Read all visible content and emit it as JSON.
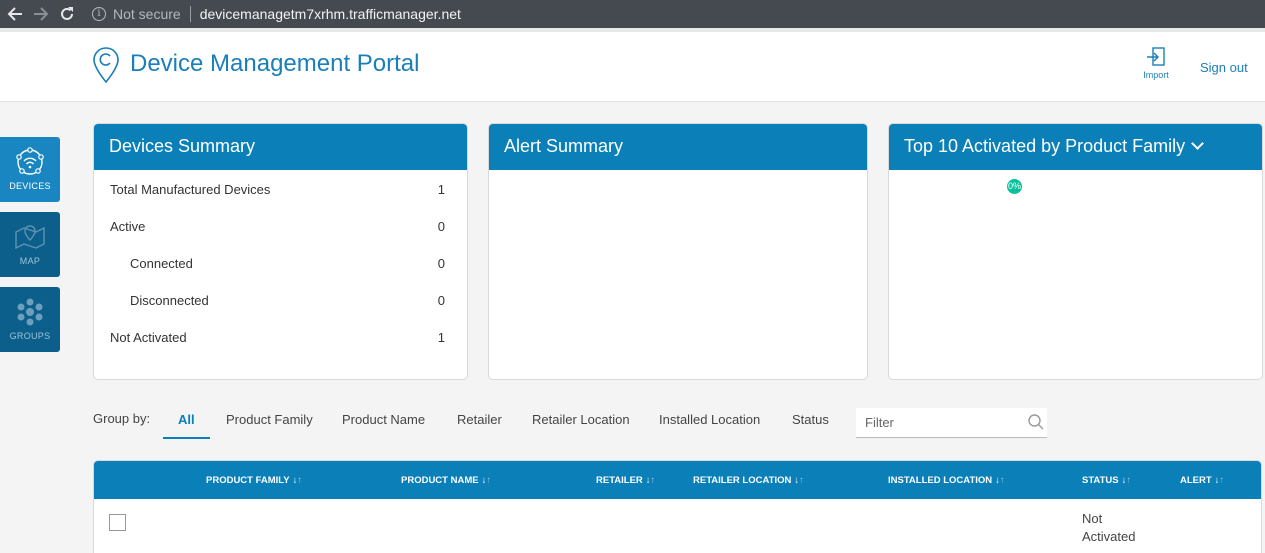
{
  "browser": {
    "not_secure": "Not secure",
    "url": "devicemanagetm7xrhm.trafficmanager.net"
  },
  "header": {
    "title": "Device Management Portal",
    "import_label": "Import",
    "signout_label": "Sign out"
  },
  "sidebar": {
    "items": [
      {
        "label": "DEVICES",
        "icon": "wifi-hub-icon",
        "active": true
      },
      {
        "label": "MAP",
        "icon": "map-icon",
        "active": false
      },
      {
        "label": "GROUPS",
        "icon": "groups-icon",
        "active": false
      }
    ]
  },
  "devices_summary": {
    "title": "Devices Summary",
    "rows": [
      {
        "label": "Total Manufactured Devices",
        "value": "1"
      },
      {
        "label": "Active",
        "value": "0"
      },
      {
        "label": "Connected",
        "value": "0"
      },
      {
        "label": "Disconnected",
        "value": "0"
      },
      {
        "label": "Not Activated",
        "value": "1"
      }
    ]
  },
  "alert_summary": {
    "title": "Alert Summary"
  },
  "top10": {
    "title": "Top 10 Activated by Product Family",
    "pie_label": "0%"
  },
  "group_by": {
    "label": "Group by:",
    "tabs": [
      "All",
      "Product Family",
      "Product Name",
      "Retailer",
      "Retailer Location",
      "Installed Location",
      "Status"
    ],
    "active_tab": "All",
    "filter_placeholder": "Filter"
  },
  "table": {
    "columns": [
      "PRODUCT FAMILY",
      "PRODUCT NAME",
      "RETAILER",
      "RETAILER LOCATION",
      "INSTALLED LOCATION",
      "STATUS",
      "ALERT"
    ],
    "sort_down": "↓",
    "sort_up": "↑",
    "rows": [
      {
        "status": "Not Activated"
      }
    ]
  },
  "colors": {
    "primary": "#0a7fb8",
    "sidebar_active": "#1a86c1",
    "sidebar_inactive": "#0c5f8a",
    "pie_slice": "#0abf9b"
  }
}
